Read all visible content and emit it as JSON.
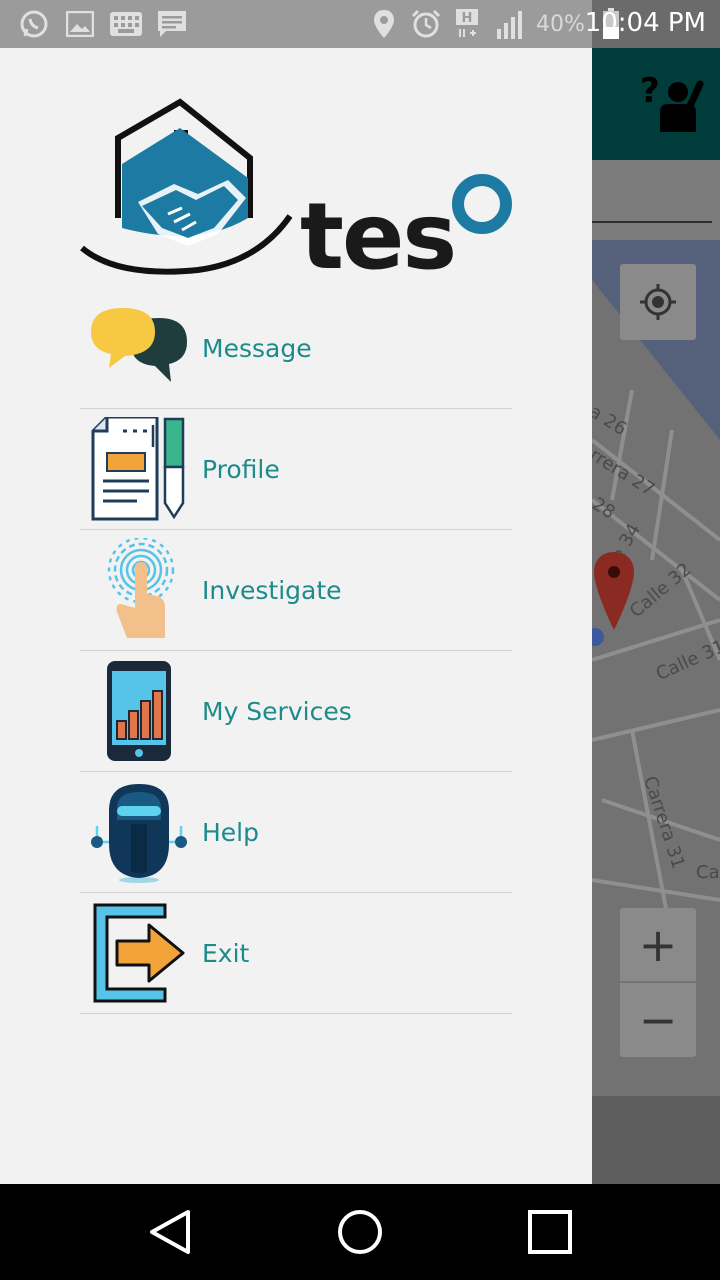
{
  "status_bar": {
    "battery_percent": "40%",
    "time": "10:04 PM",
    "icons_left": [
      "whatsapp-icon",
      "image-icon",
      "keyboard-icon",
      "message-icon"
    ],
    "icons_right": [
      "location-icon",
      "alarm-icon",
      "h-plus-icon",
      "signal-icon",
      "battery-icon"
    ]
  },
  "drawer": {
    "logo_text": "teso",
    "menu": [
      {
        "label": "Message",
        "icon": "message-bubbles-icon"
      },
      {
        "label": "Profile",
        "icon": "profile-document-icon"
      },
      {
        "label": "Investigate",
        "icon": "fingerprint-touch-icon"
      },
      {
        "label": "My Services",
        "icon": "phone-chart-icon"
      },
      {
        "label": "Help",
        "icon": "robot-icon"
      },
      {
        "label": "Exit",
        "icon": "exit-arrow-icon"
      }
    ]
  },
  "map": {
    "streets": [
      "a 26",
      "rrera 27",
      "28",
      "e 34",
      "Calle 32",
      "Calle 31",
      "Carrera 31",
      "Ca"
    ],
    "zoom_in": "+",
    "zoom_out": "−"
  },
  "colors": {
    "accent_teal": "#1d8b8b",
    "brand_blue": "#1c7aa3",
    "drawer_bg": "#f2f2f2",
    "app_bar": "#003c3a"
  }
}
